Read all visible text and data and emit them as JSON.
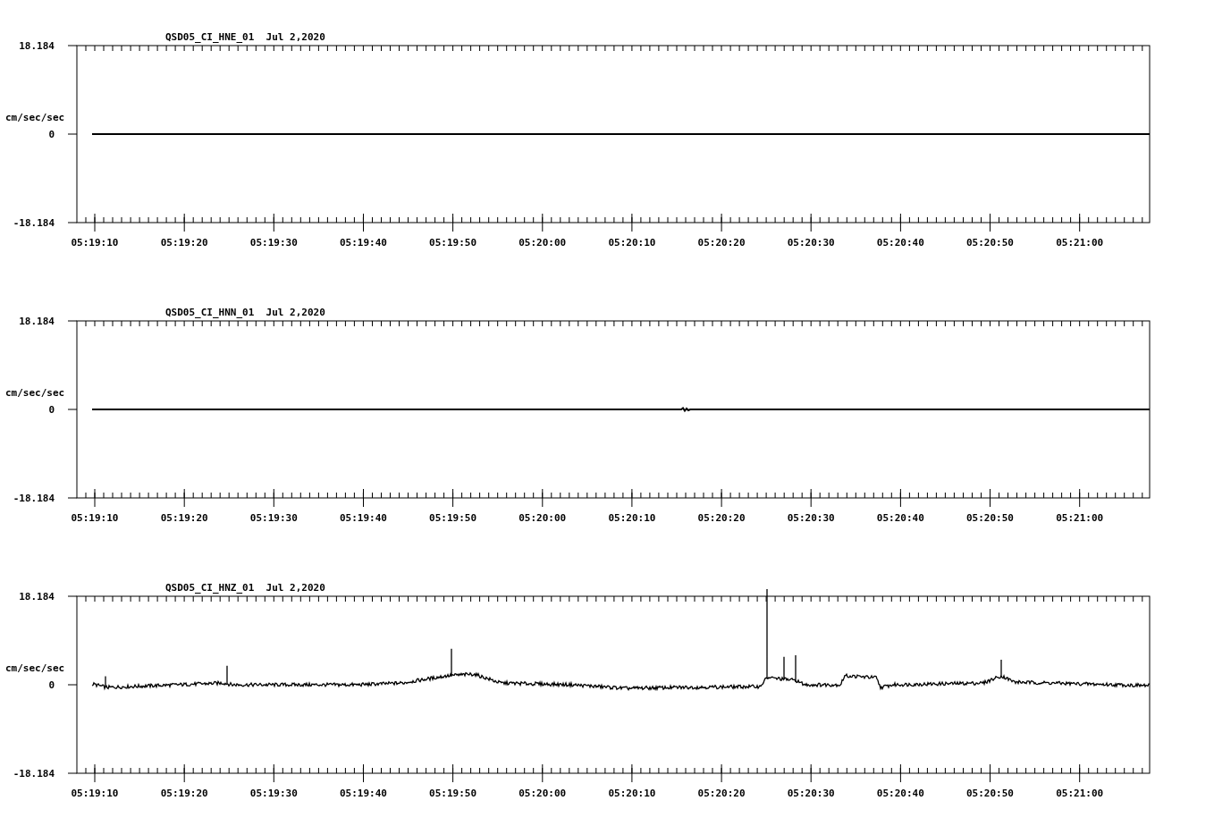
{
  "panels": [
    {
      "kind": "flat",
      "title": "QSD05_CI_HNE_01  Jul 2,2020",
      "ylabel": "cm/sec/sec",
      "yticks": [
        "18.184",
        "0",
        "-18.184"
      ],
      "xticks": [
        "05:19:10",
        "05:19:20",
        "05:19:30",
        "05:19:40",
        "05:19:50",
        "05:20:00",
        "05:20:10",
        "05:20:20",
        "05:20:30",
        "05:20:40",
        "05:20:50",
        "05:21:00"
      ]
    },
    {
      "kind": "blip",
      "title": "QSD05_CI_HNN_01  Jul 2,2020",
      "ylabel": "cm/sec/sec",
      "yticks": [
        "18.184",
        "0",
        "-18.184"
      ],
      "xticks": [
        "05:19:10",
        "05:19:20",
        "05:19:30",
        "05:19:40",
        "05:19:50",
        "05:20:00",
        "05:20:10",
        "05:20:20",
        "05:20:30",
        "05:20:40",
        "05:20:50",
        "05:21:00"
      ]
    },
    {
      "kind": "waveform",
      "title": "QSD05_CI_HNZ_01  Jul 2,2020",
      "ylabel": "cm/sec/sec",
      "yticks": [
        "18.184",
        "0",
        "-18.184"
      ],
      "xticks": [
        "05:19:10",
        "05:19:20",
        "05:19:30",
        "05:19:40",
        "05:19:50",
        "05:20:00",
        "05:20:10",
        "05:20:20",
        "05:20:30",
        "05:20:40",
        "05:20:50",
        "05:21:00"
      ]
    }
  ]
}
